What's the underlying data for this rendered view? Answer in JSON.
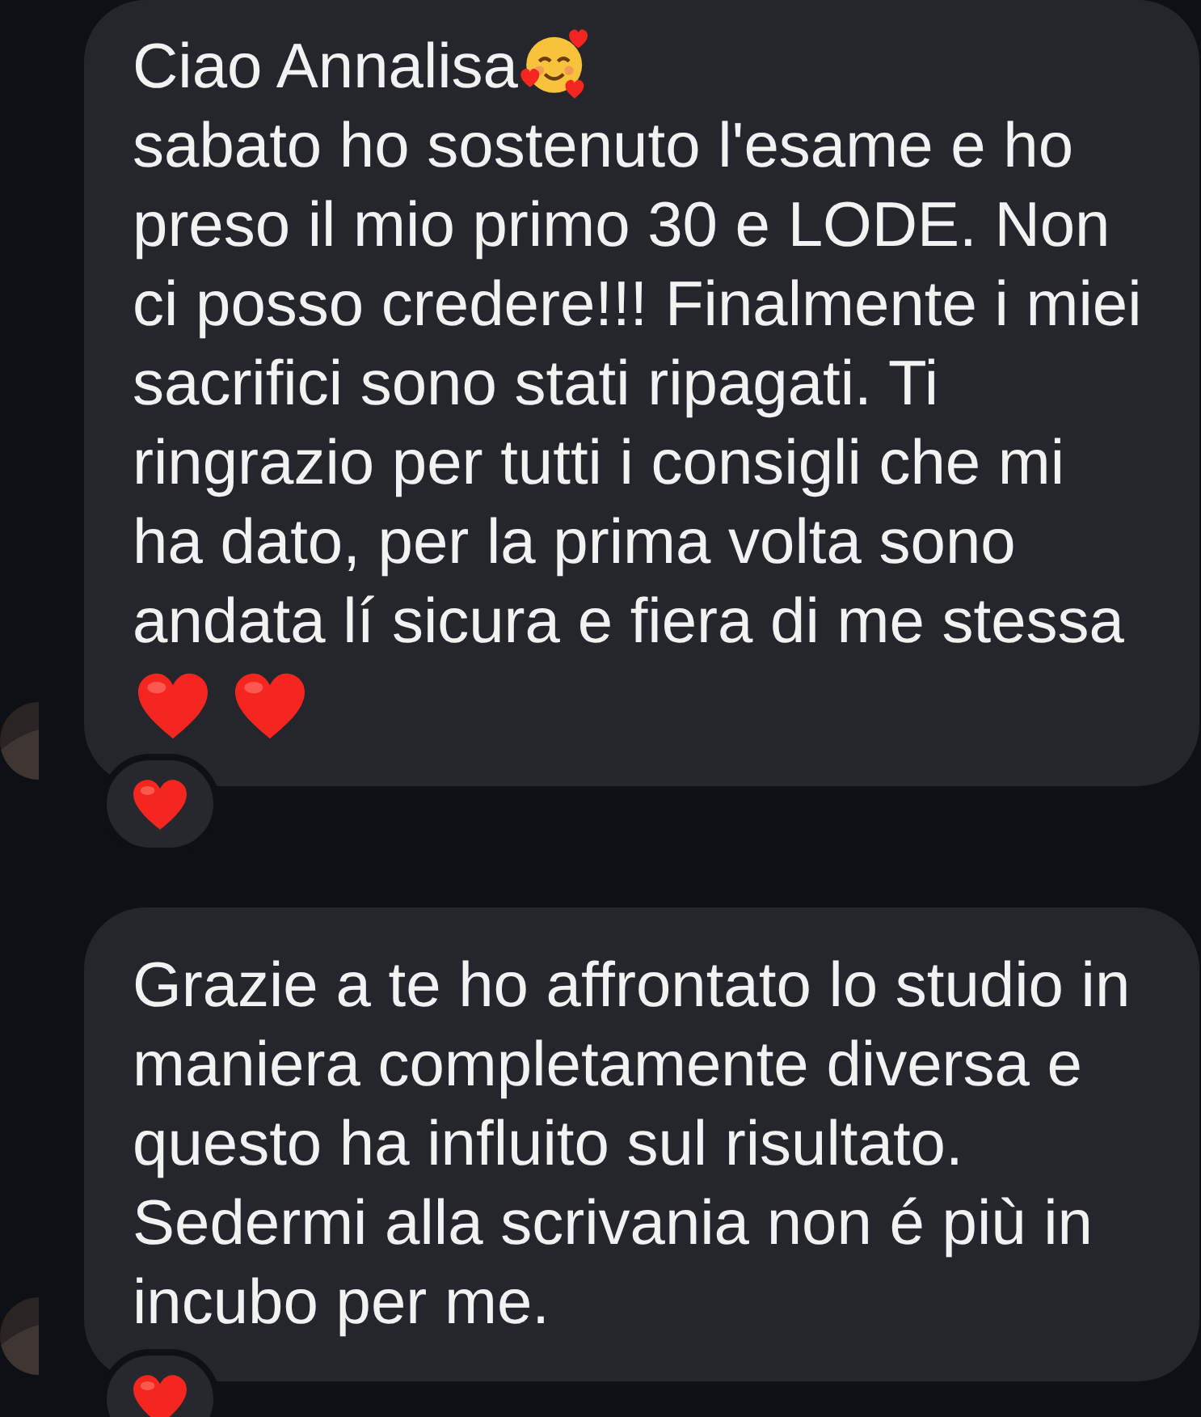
{
  "messages": [
    {
      "lines": [
        "Ciao Annalisa",
        "sabato ho sostenuto l'esame e ho",
        "preso il mio primo 30 e LODE. Non",
        "ci posso credere!!! Finalmente i miei",
        "sacrifici sono stati ripagati. Ti",
        "ringrazio per tutti i consigli che mi",
        "ha dato, per la prima volta sono",
        "andata lí sicura e fiera di me stessa"
      ],
      "first_line_emoji": {
        "kind": "smiling"
      },
      "emoji_row": [
        {
          "kind": "heart"
        },
        {
          "kind": "heart"
        }
      ],
      "reaction": {
        "kind": "heart"
      }
    },
    {
      "lines": [
        "Grazie a te ho affrontato lo studio in",
        "maniera completamente diversa e",
        "questo ha influito sul risultato.",
        "Sedermi alla scrivania non é più in",
        "incubo per me."
      ],
      "reaction": {
        "kind": "heart"
      }
    }
  ]
}
